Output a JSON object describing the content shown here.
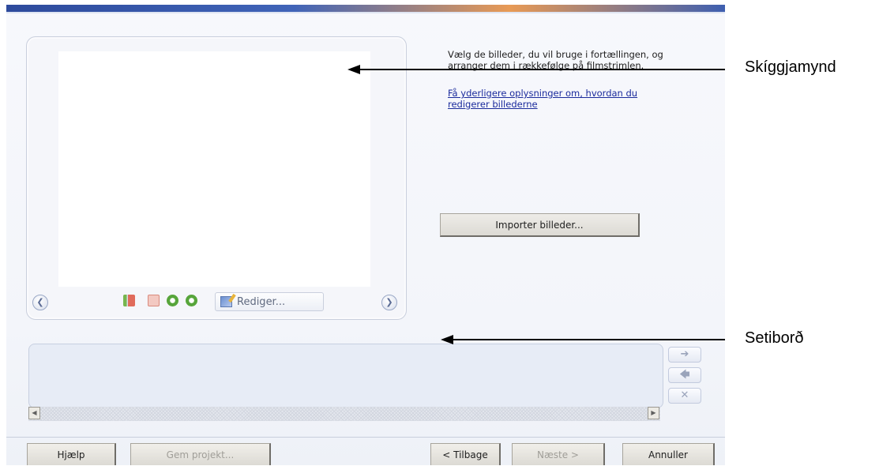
{
  "instructions": "Vælg de billeder, du vil bruge i fortællingen, og arranger dem i rækkefølge på filmstrimlen.",
  "help_link": "Få yderligere oplysninger om, hvordan du redigerer billederne",
  "import_button": "Importer billeder...",
  "preview_toolbar": {
    "edit_button": "Rediger..."
  },
  "annotations": {
    "preview": "Skíggjamynd",
    "storyboard": "Setiborð"
  },
  "footer": {
    "help": "Hjælp",
    "save_project": "Gem projekt...",
    "back": "< Tilbage",
    "next": "Næste >",
    "cancel": "Annuller"
  },
  "icons": {
    "prev": "chevron-left-icon",
    "next": "chevron-right-icon",
    "right": "arrow-right-icon",
    "left": "arrow-left-icon",
    "delete": "close-icon"
  }
}
